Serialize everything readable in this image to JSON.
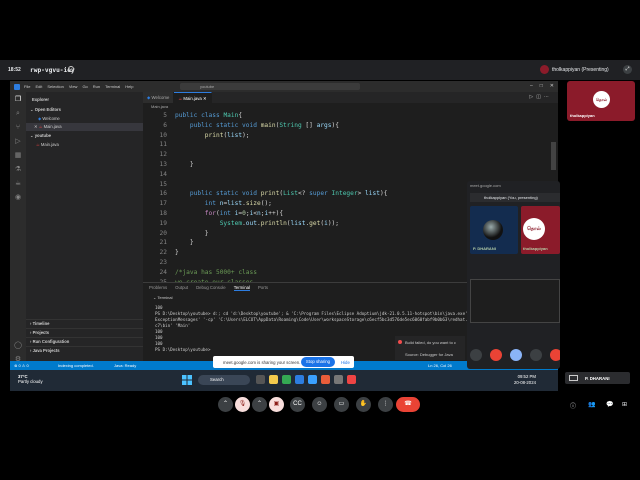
{
  "meet": {
    "time": "18:52",
    "meeting_code": "rwp-vgvu-iey",
    "presenter_label": "tholkappiyan (Presenting)",
    "self_name": "tholkappiyan",
    "pip": {
      "url": "meet.google.com",
      "presenting_bar": "tholkappiyan (You, presenting)",
      "participant1": "P. DHARANI",
      "participant2": "tholkappiyan"
    },
    "side_tile_name": "P. DHARANI",
    "sharing_text": "meet.google.com is sharing your screen.",
    "stop_sharing": "Stop sharing",
    "hide": "Hide"
  },
  "vscode": {
    "menu": [
      "File",
      "Edit",
      "Selection",
      "View",
      "Go",
      "Run",
      "Terminal",
      "Help"
    ],
    "search_placeholder": "youtube",
    "sidebar": {
      "title": "Explorer",
      "open_editors": "Open Editors",
      "open_items": [
        "Welcome",
        "Main.java"
      ],
      "folder": "youtube",
      "files": [
        "Main.java"
      ],
      "sections": [
        "Timeline",
        "Projects",
        "Run Configuration",
        "Java Projects"
      ]
    },
    "tabs": [
      "Welcome",
      "Main.java"
    ],
    "breadcrumb": "Main.java",
    "code_lines": [
      {
        "n": "5",
        "segs": [
          [
            "k",
            "public class "
          ],
          [
            "ty",
            "Main"
          ],
          [
            "pu",
            "{"
          ]
        ]
      },
      {
        "n": "6",
        "segs": [
          [
            "k",
            "    public static void "
          ],
          [
            "fn",
            "main"
          ],
          [
            "pu",
            "("
          ],
          [
            "ty",
            "String"
          ],
          [
            "pu",
            " [] "
          ],
          [
            "vr",
            "args"
          ],
          [
            "pu",
            ")"
          ],
          [
            "pu",
            "{"
          ]
        ]
      },
      {
        "n": "10",
        "segs": [
          [
            "fn",
            "        print"
          ],
          [
            "pu",
            "("
          ],
          [
            "vr",
            "list"
          ],
          [
            "pu",
            ");"
          ]
        ]
      },
      {
        "n": "11",
        "segs": []
      },
      {
        "n": "12",
        "segs": []
      },
      {
        "n": "13",
        "segs": [
          [
            "pu",
            "    }"
          ]
        ]
      },
      {
        "n": "14",
        "segs": []
      },
      {
        "n": "15",
        "segs": []
      },
      {
        "n": "16",
        "segs": [
          [
            "k",
            "    public static void "
          ],
          [
            "fn",
            "print"
          ],
          [
            "pu",
            "("
          ],
          [
            "ty",
            "List"
          ],
          [
            "pu",
            "<? "
          ],
          [
            "k",
            "super "
          ],
          [
            "ty",
            "Integer"
          ],
          [
            "pu",
            "> "
          ],
          [
            "vr",
            "list"
          ],
          [
            "pu",
            ")"
          ],
          [
            "pu",
            "{"
          ]
        ]
      },
      {
        "n": "17",
        "segs": [
          [
            "k",
            "        int "
          ],
          [
            "vr",
            "n"
          ],
          [
            "pu",
            "="
          ],
          [
            "vr",
            "list"
          ],
          [
            "pu",
            "."
          ],
          [
            "fn",
            "size"
          ],
          [
            "pu",
            "();"
          ]
        ]
      },
      {
        "n": "18",
        "segs": [
          [
            "ctl",
            "        for"
          ],
          [
            "pu",
            "("
          ],
          [
            "k",
            "int "
          ],
          [
            "vr",
            "i"
          ],
          [
            "pu",
            "="
          ],
          [
            "nm",
            "0"
          ],
          [
            "pu",
            ";"
          ],
          [
            "vr",
            "i"
          ],
          [
            "pu",
            "<"
          ],
          [
            "vr",
            "n"
          ],
          [
            "pu",
            ";"
          ],
          [
            "vr",
            "i"
          ],
          [
            "pu",
            "++){"
          ]
        ]
      },
      {
        "n": "19",
        "segs": [
          [
            "ty",
            "            System"
          ],
          [
            "pu",
            "."
          ],
          [
            "vr",
            "out"
          ],
          [
            "pu",
            "."
          ],
          [
            "fn",
            "println"
          ],
          [
            "pu",
            "("
          ],
          [
            "vr",
            "list"
          ],
          [
            "pu",
            "."
          ],
          [
            "fn",
            "get"
          ],
          [
            "pu",
            "("
          ],
          [
            "vr",
            "i"
          ],
          [
            "pu",
            "));"
          ]
        ]
      },
      {
        "n": "20",
        "segs": [
          [
            "pu",
            "        }"
          ]
        ]
      },
      {
        "n": "21",
        "segs": [
          [
            "pu",
            "    }"
          ]
        ]
      },
      {
        "n": "22",
        "segs": [
          [
            "pu",
            "}"
          ]
        ]
      },
      {
        "n": "23",
        "segs": []
      },
      {
        "n": "24",
        "segs": [
          [
            "cm",
            "/*java has 5000+ class"
          ]
        ]
      },
      {
        "n": "25",
        "segs": [
          [
            "cm",
            "we create our classes"
          ]
        ]
      }
    ],
    "panel_tabs": [
      "Problems",
      "Output",
      "Debug Console",
      "Terminal",
      "Ports"
    ],
    "terminal_header": "Terminal",
    "terminal_lines": [
      "100",
      "PS D:\\Desktop\\youtube> d:; cd 'd:\\Desktop\\youtube'; & 'C:\\Program Files\\Eclipse Adoptium\\jdk-21.0.5.11-hotspot\\bin\\java.exe' '-XX:+Show",
      "ExceptionMessages' '-cp' 'C:\\Users\\ELCOT\\AppData\\Roaming\\Code\\User\\workspaceStorage\\c6ecf5bc3d576de5ec6060fabf9b0b63\\redhat.java\\jdt_ws\\youtube_6",
      "c7\\bin' 'Main'",
      "100",
      "100",
      "100",
      "PS D:\\Desktop\\youtube> "
    ],
    "status": {
      "left": "Indexing completed.",
      "java": "Java: Ready",
      "pos": "Ln 26, Col 26"
    },
    "toast": {
      "line1": "Build failed, do you want to c",
      "line2": "Source: Debugger for Java"
    }
  },
  "taskbar": {
    "temp": "37°C",
    "weather": "Partly cloudy",
    "search": "Search",
    "time": "09:52 PM",
    "date": "20-08-2024"
  }
}
